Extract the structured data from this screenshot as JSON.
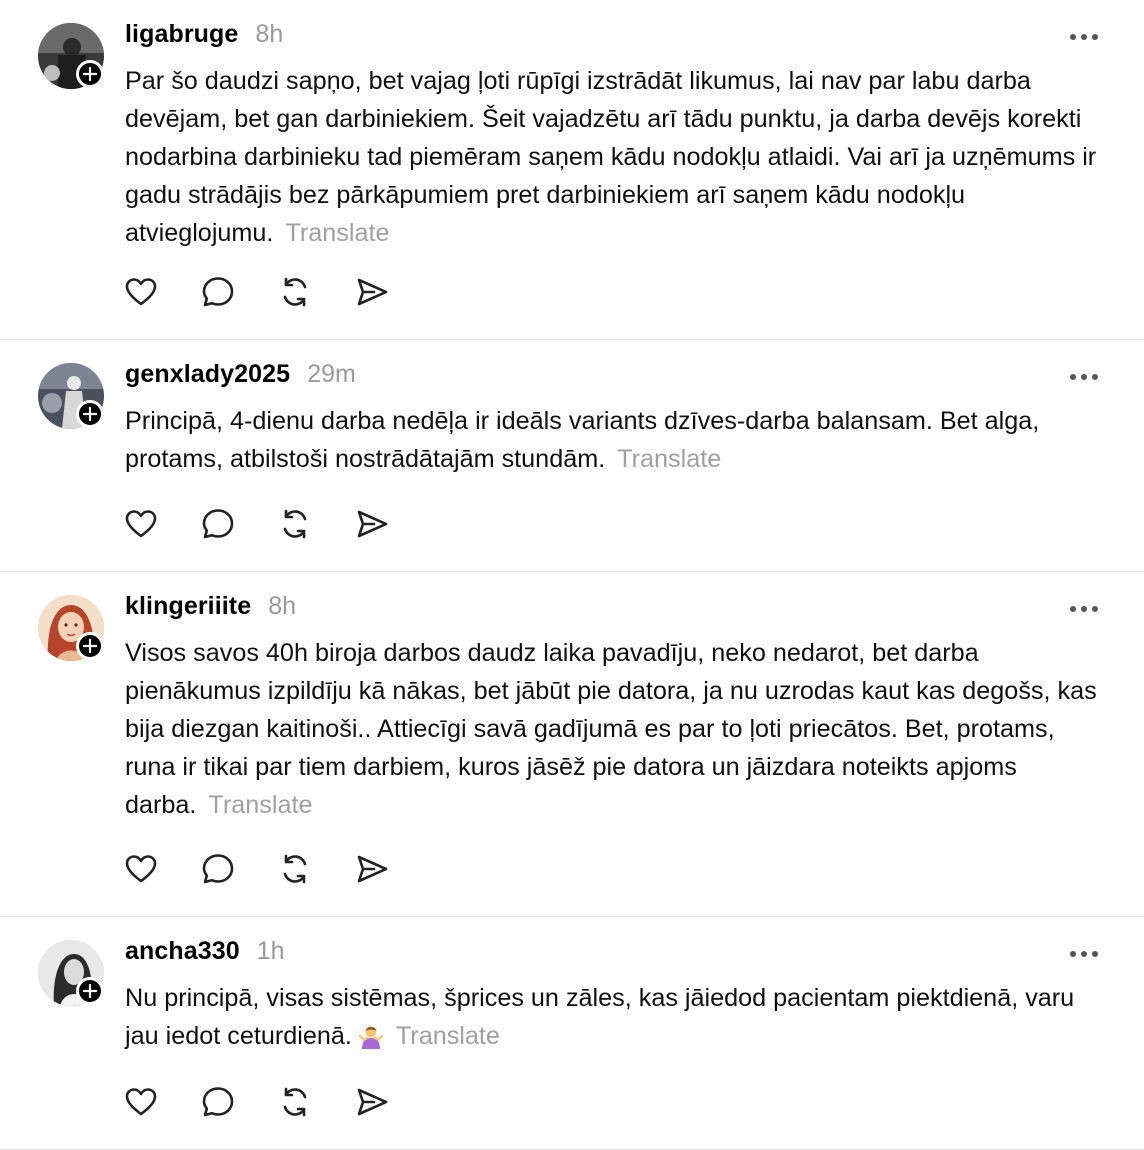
{
  "posts": [
    {
      "username": "ligabruge",
      "time": "8h",
      "text": "Par šo daudzi sapņo, bet vajag ļoti rūpīgi izstrādāt likumus, lai nav par labu darba devējam, bet gan darbiniekiem. Šeit vajadzētu arī tādu punktu, ja darba devējs korekti nodarbina darbinieku tad piemēram saņem kādu nodokļu atlaidi. Vai arī ja uzņēmums ir gadu strādājis bez pārkāpumiem pret darbiniekiem arī saņem kādu nodokļu atvieglojumu.",
      "translate": "Translate"
    },
    {
      "username": "genxlady2025",
      "time": "29m",
      "text": "Principā, 4-dienu darba nedēļa ir ideāls variants dzīves-darba balansam. Bet alga, protams, atbilstoši nostrādātajām stundām.",
      "translate": "Translate"
    },
    {
      "username": "klingeriiite",
      "time": "8h",
      "text": "Visos savos 40h biroja darbos daudz laika pavadīju, neko nedarot, bet darba pienākumus izpildīju kā nākas, bet jābūt pie datora, ja nu uzrodas kaut kas degošs, kas bija diezgan kaitinoši.. Attiecīgi savā gadījumā es par to ļoti priecātos. Bet, protams, runa ir tikai par tiem darbiem, kuros jāsēž pie datora un jāizdara noteikts apjoms darba.",
      "translate": "Translate"
    },
    {
      "username": "ancha330",
      "time": "1h",
      "text": "Nu principā, visas sistēmas, šprices un zāles, kas jāiedod pacientam piektdienā, varu jau iedot ceturdienā.",
      "emoji": "person-shrugging-emoji",
      "translate": "Translate"
    }
  ],
  "icons": {
    "like": "heart-icon",
    "reply": "comment-icon",
    "repost": "repost-icon",
    "share": "send-icon",
    "follow": "plus-icon",
    "more": "more-icon"
  },
  "colors": {
    "text": "#101010",
    "muted": "#9a9a9a",
    "divider": "#e2e2e2",
    "badge": "#000000"
  }
}
